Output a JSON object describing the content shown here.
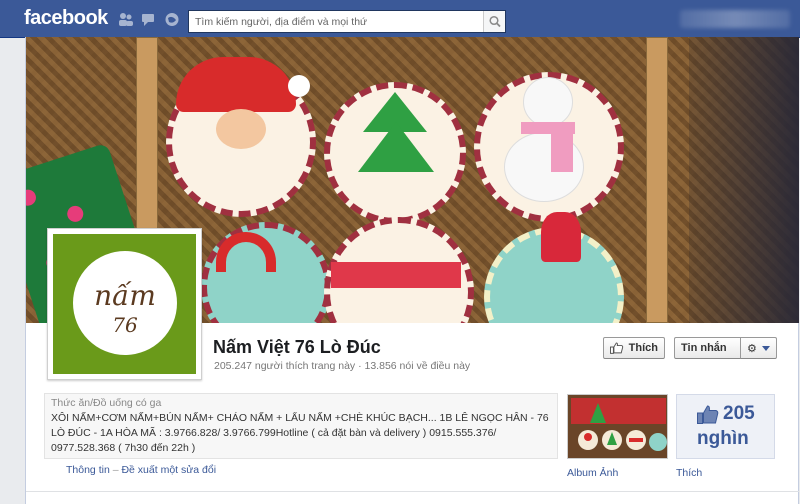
{
  "topbar": {
    "logo": "facebook",
    "search_placeholder": "Tìm kiếm người, địa điểm và mọi thứ",
    "jewels": [
      "friend-requests-icon",
      "messages-icon",
      "notifications-icon"
    ]
  },
  "page": {
    "name": "Nấm Việt 76 Lò Đúc",
    "stats": "205.247 người thích trang này · 13.856 nói về điều này",
    "category": "Thức ăn/Đồ uống có ga",
    "description": "XÔI NẤM+CƠM NẤM+BÚN NẤM+ CHÁO NẤM + LẨU NẤM +CHÈ KHÚC BẠCH... 1B LÊ NGỌC HÂN - 76 LÒ ĐÚC - 1A HÒA MÃ : 3.9766.828/ 3.9766.799Hotline ( cả đặt bàn và delivery ) 0915.555.376/ 0977.528.368 ( 7h30 đến 22h )",
    "profile_logo_text": "nấm",
    "profile_logo_number": "76"
  },
  "buttons": {
    "like": "Thích",
    "message": "Tin nhắn",
    "gear": "⚙"
  },
  "links": {
    "info": "Thông tin",
    "separator": "–",
    "suggest_edit": "Đề xuất một sửa đổi"
  },
  "apps": {
    "album_label": "Album Ảnh",
    "likes_count": "205",
    "likes_unit": "nghìn",
    "likes_label": "Thích"
  },
  "colors": {
    "brand": "#3b5998",
    "profile_bg": "#6a9a1a"
  }
}
